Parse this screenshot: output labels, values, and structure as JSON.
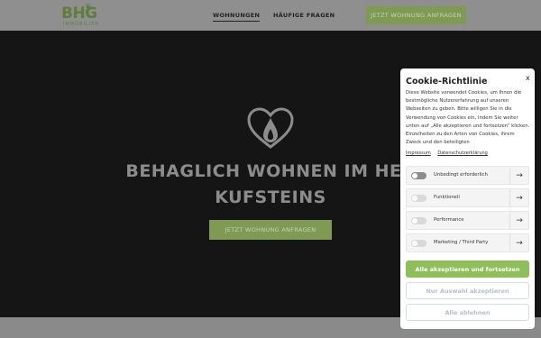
{
  "header": {
    "logo_text": "BHG",
    "logo_sub": "IMMOBILIEN",
    "nav": [
      "WOHNUNGEN",
      "HÄUFIGE FRAGEN"
    ],
    "cta_label": "JETZT WOHNUNG ANFRAGEN"
  },
  "hero": {
    "title_line1": "BEHAGLICH WOHNEN IM HER",
    "title_line2": "KUFSTEINS",
    "cta_label": "JETZT WOHNUNG ANFRAGEN"
  },
  "cookie": {
    "title": "Cookie-Richtlinie",
    "close_label": "x",
    "text": "Diese Website verwendet Cookies, um Ihnen die bestmögliche Nutzererfahrung auf unseren Webseiten zu geben. Bitte willigen Sie in die Verwendung von Cookies ein, indem Sie weiter unten auf „Alle akzeptieren und fortsetzen“ klicken. Einzelheiten zu den Arten von Cookies, ihrem Zweck und den beteiligten",
    "links": [
      "Impressum",
      "Datenschutzerklärung"
    ],
    "categories": [
      {
        "label": "Unbedingt erforderlich",
        "enabled": true
      },
      {
        "label": "Funktionell",
        "enabled": false
      },
      {
        "label": "Performance",
        "enabled": false
      },
      {
        "label": "Marketing / Third Party",
        "enabled": false
      }
    ],
    "buttons": {
      "accept_all": "Alle akzeptieren und fortsetzen",
      "accept_selection": "Nur Auswahl akzeptieren",
      "reject_all": "Alle ablehnen"
    }
  },
  "colors": {
    "brand_green": "#7e9a55",
    "accept_green": "#8fbf5a"
  }
}
